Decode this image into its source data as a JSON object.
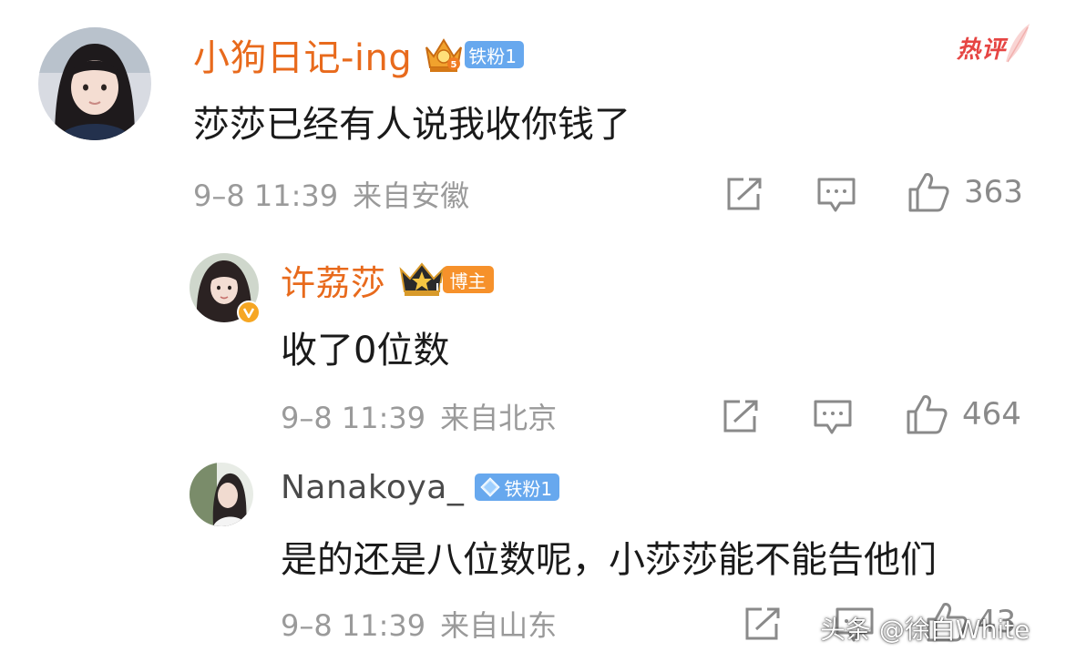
{
  "hot_tag": {
    "label": "热评",
    "color": "#e64543",
    "icon": "feather-icon"
  },
  "comments": [
    {
      "username": "小狗日记-ing",
      "medal_icon": "crown-medal-icon",
      "badge": "铁粉1",
      "content": "莎莎已经有人说我收你钱了",
      "date": "9–8 11:39",
      "location": "来自安徽",
      "likes": "363"
    },
    {
      "username": "许荔莎",
      "medal_icon": "star-crown-icon",
      "badge": "博主",
      "verified": true,
      "content": "收了0位数",
      "date": "9–8 11:39",
      "location": "来自北京",
      "likes": "464"
    },
    {
      "username": "Nanakoya_",
      "medal_icon": "diamond-icon",
      "badge": "铁粉1",
      "content": "是的还是八位数呢，小莎莎能不能告他们",
      "date": "9–8 11:39",
      "location": "来自山东",
      "likes": "43"
    }
  ],
  "action_icons": [
    "share-icon",
    "comment-icon",
    "like-icon"
  ],
  "watermark": "头条 @徐白White",
  "colors": {
    "username": "#e86a1c",
    "badge_blue": "#67a8ee",
    "badge_orange": "#f6912b",
    "meta": "#9a9a9a"
  }
}
